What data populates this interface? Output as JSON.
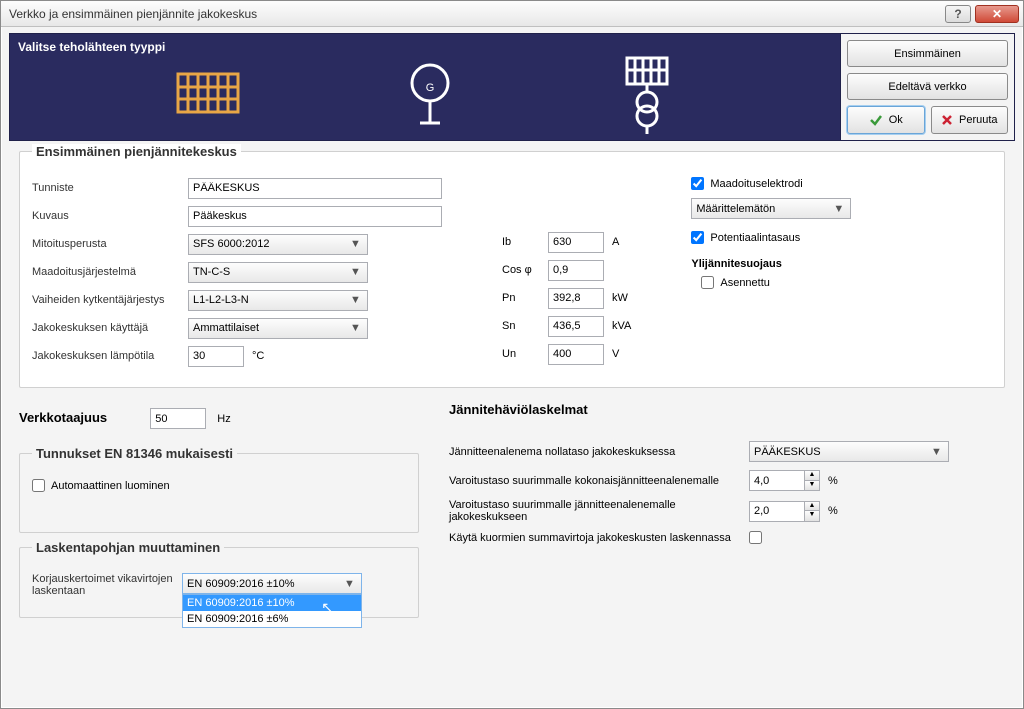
{
  "window": {
    "title": "Verkko ja ensimmäinen pienjännite jakokeskus"
  },
  "header": {
    "label": "Valitse teholähteen tyyppi",
    "btn_first": "Ensimmäinen",
    "btn_prev_net": "Edeltävä verkko",
    "btn_ok": "Ok",
    "btn_cancel": "Peruuta"
  },
  "group1": {
    "title": "Ensimmäinen pienjännitekeskus",
    "tunniste_lbl": "Tunniste",
    "tunniste_val": "PÄÄKESKUS",
    "kuvaus_lbl": "Kuvaus",
    "kuvaus_val": "Pääkeskus",
    "mitoitus_lbl": "Mitoitusperusta",
    "mitoitus_val": "SFS 6000:2012",
    "maadoitus_lbl": "Maadoitusjärjestelmä",
    "maadoitus_val": "TN-C-S",
    "vaiheet_lbl": "Vaiheiden kytkentäjärjestys",
    "vaiheet_val": "L1-L2-L3-N",
    "kayttaja_lbl": "Jakokeskuksen käyttäjä",
    "kayttaja_val": "Ammattilaiset",
    "lampo_lbl": "Jakokeskuksen lämpötila",
    "lampo_val": "30",
    "lampo_unit": "°C",
    "ib_lbl": "Ib",
    "ib_val": "630",
    "ib_unit": "A",
    "cos_lbl": "Cos φ",
    "cos_val": "0,9",
    "pn_lbl": "Pn",
    "pn_val": "392,8",
    "pn_unit": "kW",
    "sn_lbl": "Sn",
    "sn_val": "436,5",
    "sn_unit": "kVA",
    "un_lbl": "Un",
    "un_val": "400",
    "un_unit": "V",
    "maad_elek_lbl": "Maadoituselektrodi",
    "maad_select": "Määrittelemätön",
    "potent_lbl": "Potentiaalintasaus",
    "ylij_title": "Ylijännitesuojaus",
    "asenn_lbl": "Asennettu"
  },
  "verkkotaajuus": {
    "title": "Verkkotaajuus",
    "val": "50",
    "unit": "Hz"
  },
  "tunnukset": {
    "title": "Tunnukset EN 81346 mukaisesti",
    "auto_lbl": "Automaattinen luominen"
  },
  "jannitehaviot": {
    "title": "Jännitehäviölaskelmat",
    "nollataso_lbl": "Jännitteenalenema nollataso jakokeskuksessa",
    "nollataso_val": "PÄÄKESKUS",
    "varoitus_kok_lbl": "Varoitustaso suurimmalle kokonaisjännitteenalenemalle",
    "varoitus_kok_val": "4,0",
    "varoitus_jak_lbl": "Varoitustaso suurimmalle jännitteenalenemalle jakokeskukseen",
    "varoitus_jak_val": "2,0",
    "summav_lbl": "Käytä kuormien summavirtoja jakokeskusten laskennassa",
    "pct": "%"
  },
  "laskenta": {
    "title": "Laskentapohjan muuttaminen",
    "korjaus_lbl": "Korjauskertoimet vikavirtojen laskentaan",
    "selected": "EN 60909:2016 ±10%",
    "opt1": "EN 60909:2016 ±10%",
    "opt2": "EN 60909:2016 ±6%"
  }
}
